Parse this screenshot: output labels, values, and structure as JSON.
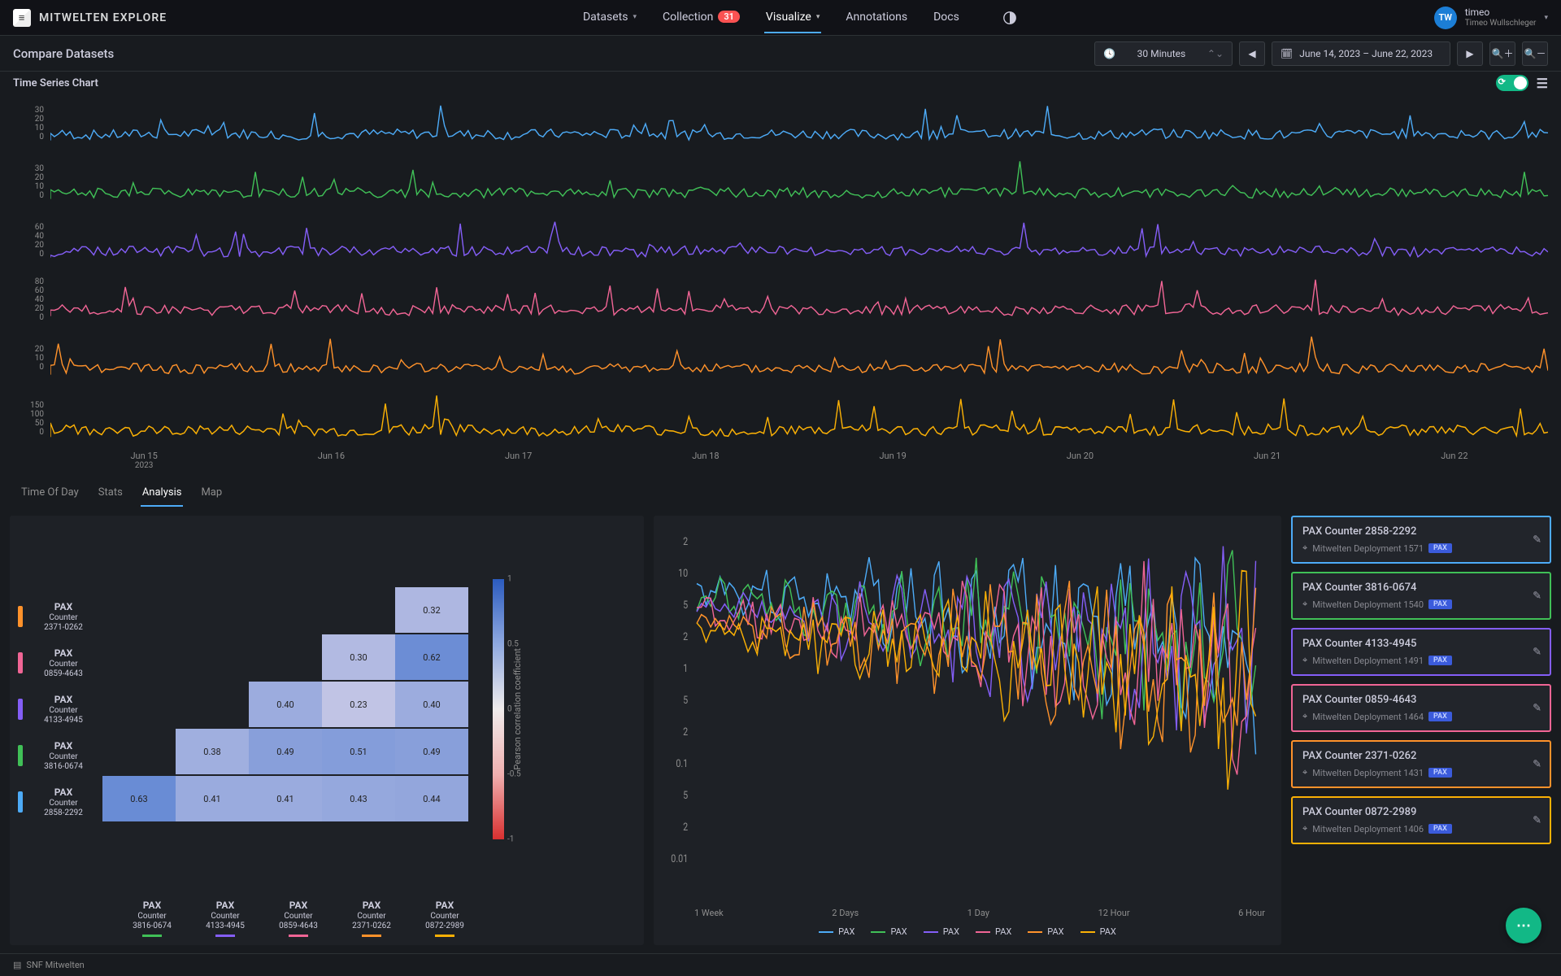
{
  "app_title": "MITWELTEN EXPLORE",
  "nav": {
    "datasets": "Datasets",
    "collection": "Collection",
    "collection_badge": "31",
    "visualize": "Visualize",
    "annotations": "Annotations",
    "docs": "Docs"
  },
  "user": {
    "initials": "TW",
    "name": "timeo",
    "full": "Timeo Wullschleger"
  },
  "toolbar": {
    "breadcrumb": "Compare Datasets",
    "interval": "30 Minutes",
    "range": "June 14, 2023 – June 22, 2023"
  },
  "panel_title": "Time Series Chart",
  "series_colors": {
    "blue": "#4dabf7",
    "green": "#40c057",
    "purple": "#845ef7",
    "pink": "#f06595",
    "orange": "#ff922b",
    "yellow": "#fab005"
  },
  "chart_data": {
    "type": "line",
    "x_ticks": [
      "Jun 15",
      "Jun 16",
      "Jun 17",
      "Jun 18",
      "Jun 19",
      "Jun 20",
      "Jun 21",
      "Jun 22"
    ],
    "x_year": "2023",
    "series": [
      {
        "name": "PAX Counter 2858-2292",
        "color": "blue",
        "y_ticks": [
          0,
          10,
          20,
          30
        ]
      },
      {
        "name": "PAX Counter 3816-0674",
        "color": "green",
        "y_ticks": [
          0,
          10,
          20,
          30
        ]
      },
      {
        "name": "PAX Counter 4133-4945",
        "color": "purple",
        "y_ticks": [
          0,
          20,
          40,
          60
        ]
      },
      {
        "name": "PAX Counter 0859-4643",
        "color": "pink",
        "y_ticks": [
          0,
          20,
          40,
          60,
          80
        ]
      },
      {
        "name": "PAX Counter 2371-0262",
        "color": "orange",
        "y_ticks": [
          0,
          10,
          20
        ]
      },
      {
        "name": "PAX Counter 0872-2989",
        "color": "yellow",
        "y_ticks": [
          0,
          50,
          100,
          150
        ]
      }
    ]
  },
  "tabs": [
    "Time Of Day",
    "Stats",
    "Analysis",
    "Map"
  ],
  "active_tab": "Analysis",
  "heatmap": {
    "type": "heatmap",
    "rows": [
      {
        "label": "PAX",
        "sub": "Counter",
        "id": "2371-0262",
        "color": "orange"
      },
      {
        "label": "PAX",
        "sub": "Counter",
        "id": "0859-4643",
        "color": "pink"
      },
      {
        "label": "PAX",
        "sub": "Counter",
        "id": "4133-4945",
        "color": "purple"
      },
      {
        "label": "PAX",
        "sub": "Counter",
        "id": "3816-0674",
        "color": "green"
      },
      {
        "label": "PAX",
        "sub": "Counter",
        "id": "2858-2292",
        "color": "blue"
      }
    ],
    "cols": [
      {
        "label": "PAX",
        "sub": "Counter",
        "id": "3816-0674",
        "color": "green"
      },
      {
        "label": "PAX",
        "sub": "Counter",
        "id": "4133-4945",
        "color": "purple"
      },
      {
        "label": "PAX",
        "sub": "Counter",
        "id": "0859-4643",
        "color": "pink"
      },
      {
        "label": "PAX",
        "sub": "Counter",
        "id": "2371-0262",
        "color": "orange"
      },
      {
        "label": "PAX",
        "sub": "Counter",
        "id": "0872-2989",
        "color": "yellow"
      }
    ],
    "cells": [
      {
        "r": 0,
        "c": 4,
        "v": 0.32
      },
      {
        "r": 1,
        "c": 3,
        "v": 0.3
      },
      {
        "r": 1,
        "c": 4,
        "v": 0.62
      },
      {
        "r": 2,
        "c": 2,
        "v": 0.4
      },
      {
        "r": 2,
        "c": 3,
        "v": 0.23
      },
      {
        "r": 2,
        "c": 4,
        "v": 0.4
      },
      {
        "r": 3,
        "c": 1,
        "v": 0.38
      },
      {
        "r": 3,
        "c": 2,
        "v": 0.49
      },
      {
        "r": 3,
        "c": 3,
        "v": 0.51
      },
      {
        "r": 3,
        "c": 4,
        "v": 0.49
      },
      {
        "r": 4,
        "c": 0,
        "v": 0.63
      },
      {
        "r": 4,
        "c": 1,
        "v": 0.41
      },
      {
        "r": 4,
        "c": 2,
        "v": 0.41
      },
      {
        "r": 4,
        "c": 3,
        "v": 0.43
      },
      {
        "r": 4,
        "c": 4,
        "v": 0.44
      }
    ],
    "colorbar": {
      "label": "Pearson correlation coefficient",
      "ticks": [
        "1",
        "0.5",
        "0",
        "-0.5",
        "-1"
      ]
    }
  },
  "mini_chart": {
    "type": "line",
    "y_ticks": [
      "2",
      "10",
      "5",
      "2",
      "1",
      "5",
      "2",
      "0.1",
      "5",
      "2",
      "0.01"
    ],
    "x_ticks": [
      "1 Week",
      "2 Days",
      "1 Day",
      "12 Hour",
      "6 Hour"
    ],
    "legend": [
      "PAX",
      "PAX",
      "PAX",
      "PAX",
      "PAX",
      "PAX"
    ]
  },
  "side_list": [
    {
      "title": "PAX Counter 2858-2292",
      "deploy": "Mitwelten Deployment 1571",
      "tag": "PAX",
      "color": "blue"
    },
    {
      "title": "PAX Counter 3816-0674",
      "deploy": "Mitwelten Deployment 1540",
      "tag": "PAX",
      "color": "green"
    },
    {
      "title": "PAX Counter 4133-4945",
      "deploy": "Mitwelten Deployment 1491",
      "tag": "PAX",
      "color": "purple"
    },
    {
      "title": "PAX Counter 0859-4643",
      "deploy": "Mitwelten Deployment 1464",
      "tag": "PAX",
      "color": "pink"
    },
    {
      "title": "PAX Counter 2371-0262",
      "deploy": "Mitwelten Deployment 1431",
      "tag": "PAX",
      "color": "orange"
    },
    {
      "title": "PAX Counter 0872-2989",
      "deploy": "Mitwelten Deployment 1406",
      "tag": "PAX",
      "color": "yellow"
    }
  ],
  "footer": "SNF Mitwelten"
}
